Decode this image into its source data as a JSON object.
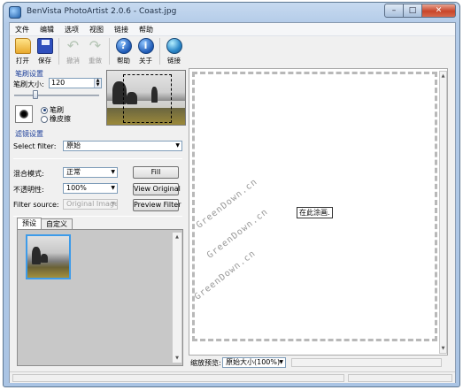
{
  "window": {
    "title": "BenVista PhotoArtist 2.0.6 - Coast.jpg"
  },
  "menu": {
    "items": [
      "文件",
      "编辑",
      "选项",
      "视图",
      "链接",
      "帮助"
    ]
  },
  "toolbar": {
    "open": "打开",
    "save": "保存",
    "undo": "撤消",
    "redo": "重做",
    "help": "帮助",
    "about": "关于",
    "link": "链接"
  },
  "brush": {
    "group_title": "笔刷设置",
    "size_label": "笔刷大小:",
    "size_value": "120",
    "option_brush": "笔刷",
    "option_eraser": "橡皮擦",
    "selected": "brush"
  },
  "filter": {
    "group_title": "滤镜设置",
    "select_label": "Select filter:",
    "select_value": "原始",
    "blend_label": "混合模式:",
    "blend_value": "正常",
    "opacity_label": "不透明性:",
    "opacity_value": "100%",
    "source_label": "Filter source:",
    "source_value": "Original Image",
    "fill_button": "Fill",
    "view_original_button": "View Original",
    "preview_filter_button": "Preview Filter"
  },
  "tabs": {
    "preset": "预设",
    "custom": "自定义"
  },
  "canvas": {
    "hint": "在此涂画.",
    "watermark_1": "GreenDown.cn",
    "watermark_2": "GreenDown.cn",
    "watermark_3": "GreenDown.cn"
  },
  "zoom": {
    "label": "缩放预览:",
    "value": "原始大小(100%)"
  },
  "colors": {
    "accent": "#3d9be9",
    "close_button": "#c8452a",
    "group_title": "#1a3d99"
  }
}
